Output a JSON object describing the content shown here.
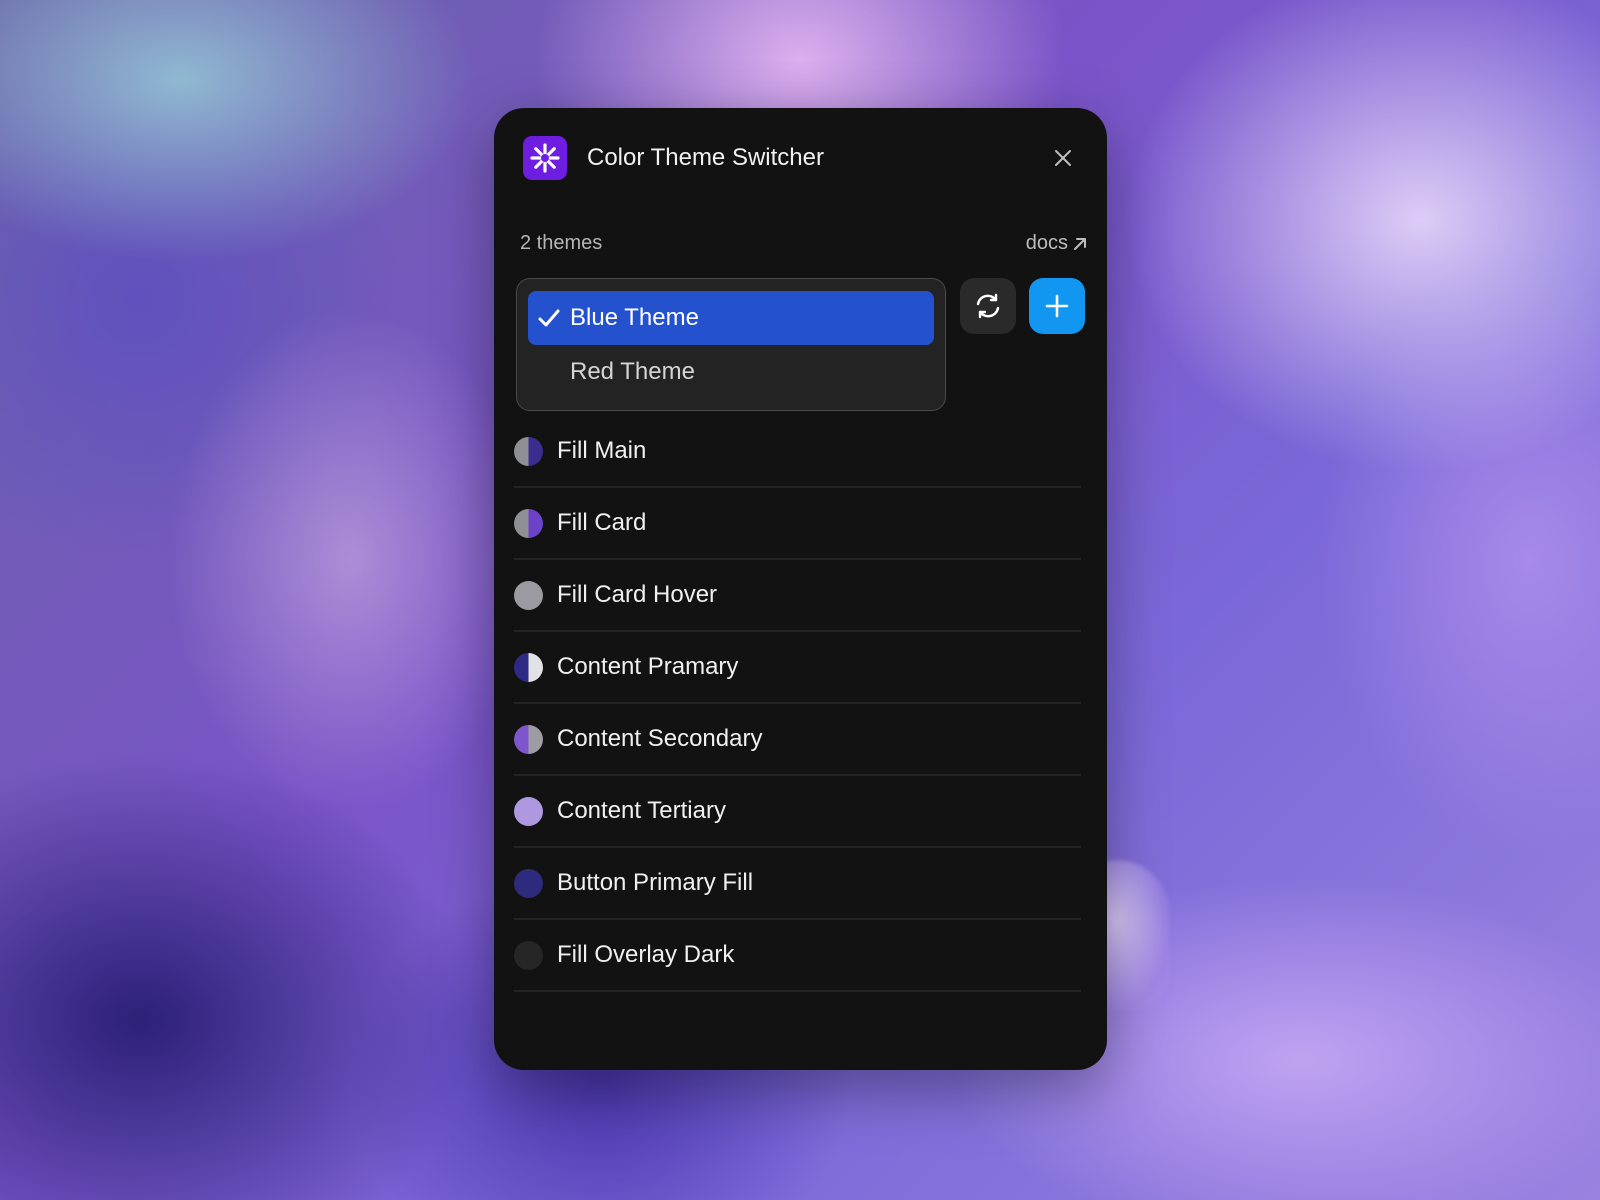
{
  "window": {
    "title": "Color Theme Switcher",
    "app_icon": "snowflake-asterisk-icon",
    "close_icon": "close-icon"
  },
  "themes": {
    "count_label": "2 themes",
    "docs_label": "docs",
    "docs_icon": "arrow-up-right-icon",
    "options": [
      {
        "label": "Blue Theme",
        "selected": true
      },
      {
        "label": "Red Theme",
        "selected": false
      }
    ],
    "refresh_icon": "refresh-icon",
    "add_icon": "plus-icon"
  },
  "tokens": [
    {
      "label": "Fill Main",
      "swatch_left": "#8f8f96",
      "swatch_right": "#3b2d8f"
    },
    {
      "label": "Fill Card",
      "swatch_left": "#8f8f96",
      "swatch_right": "#6c43c8"
    },
    {
      "label": "Fill Card Hover",
      "swatch_left": "#9a9aa0",
      "swatch_right": "#9a9aa0"
    },
    {
      "label": "Content Pramary",
      "swatch_left": "#2f2a86",
      "swatch_right": "#e2e2e4"
    },
    {
      "label": "Content Secondary",
      "swatch_left": "#7e56cc",
      "swatch_right": "#9c9ca2"
    },
    {
      "label": "Content Tertiary",
      "swatch_left": "#ae98e0",
      "swatch_right": "#ae98e0"
    },
    {
      "label": "Button Primary Fill",
      "swatch_left": "#2e2a7e",
      "swatch_right": "#2e2a7e"
    },
    {
      "label": "Fill Overlay Dark",
      "swatch_left": "#262626",
      "swatch_right": "#262626"
    }
  ],
  "colors": {
    "panel_bg": "#121212",
    "selected_option": "#2452cf",
    "add_button": "#1197f2",
    "app_icon_bg": "#6d1ee0"
  }
}
